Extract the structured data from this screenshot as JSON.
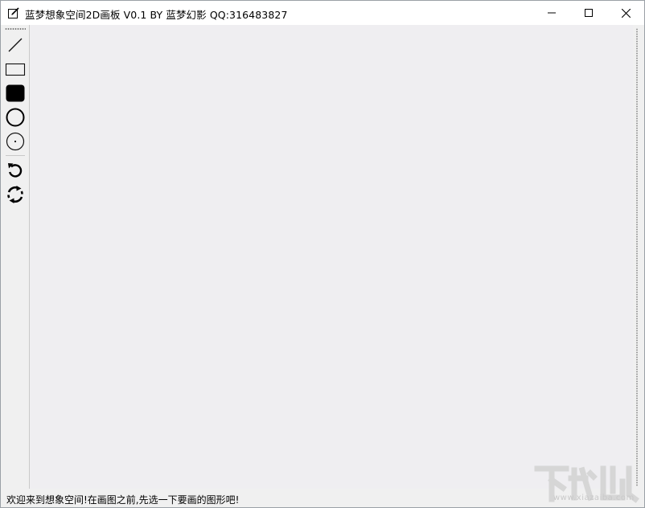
{
  "window": {
    "title": "蓝梦想象空间2D画板 V0.1 BY 蓝梦幻影 QQ:316483827",
    "controls": {
      "minimize": "minimize",
      "maximize": "maximize",
      "close": "close"
    }
  },
  "toolbar": {
    "tools": [
      {
        "id": "line",
        "icon": "line-icon"
      },
      {
        "id": "rectangle",
        "icon": "rectangle-outline-icon"
      },
      {
        "id": "filled-rectangle",
        "icon": "rounded-rectangle-filled-icon"
      },
      {
        "id": "circle",
        "icon": "circle-outline-icon"
      },
      {
        "id": "circle-center",
        "icon": "circle-with-center-dot-icon"
      },
      {
        "id": "undo",
        "icon": "undo-icon"
      },
      {
        "id": "refresh",
        "icon": "refresh-icon"
      }
    ]
  },
  "canvas": {
    "background": "#efeef1"
  },
  "statusbar": {
    "text": "欢迎来到想象空间!在画图之前,先选一下要画的图形吧!"
  },
  "watermark": {
    "text": "下载吧",
    "url": "www.xiazaiba.com"
  }
}
